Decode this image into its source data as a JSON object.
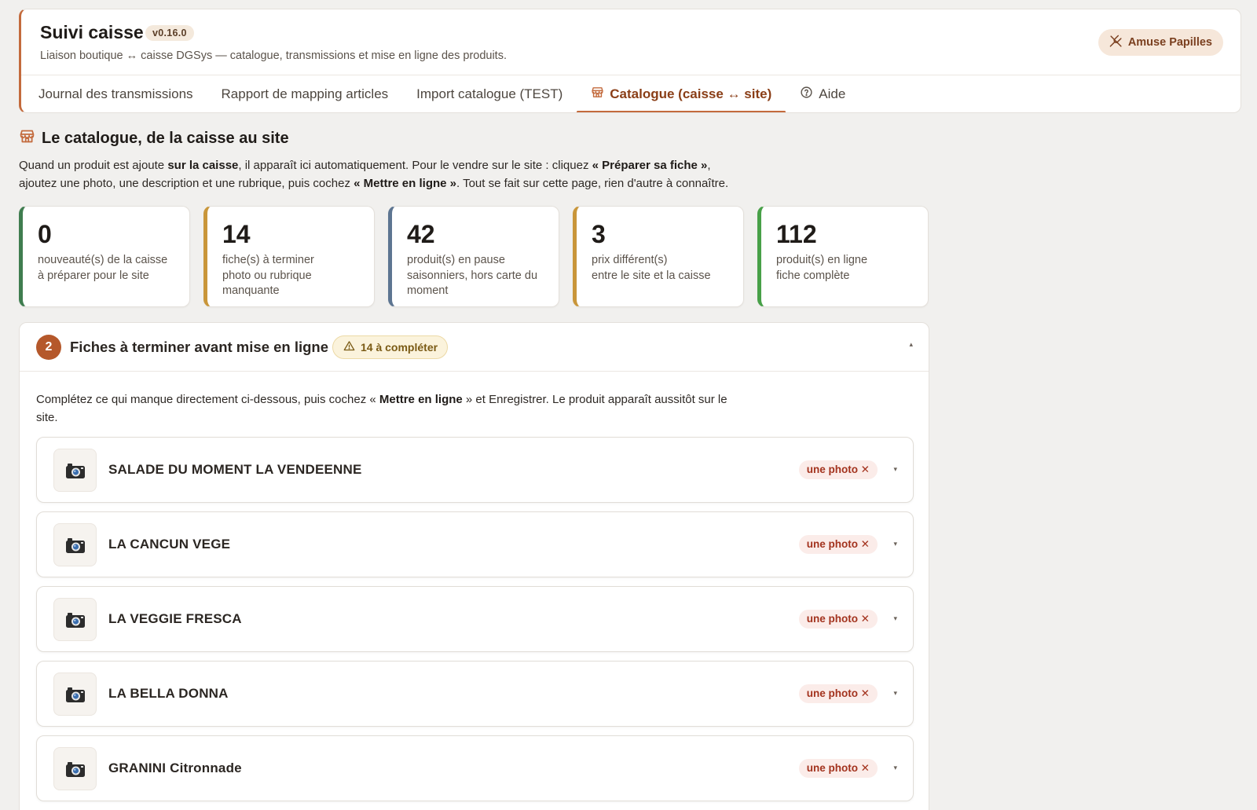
{
  "app": {
    "title": "Suivi caisse",
    "version": "v0.16.0",
    "subtitle": "Liaison boutique ↔ caisse DGSys — catalogue, transmissions et mise en ligne des produits.",
    "shop_label": "Amuse Papilles",
    "shop_icon": "utensils-crossed-icon"
  },
  "tabs": [
    {
      "label": "Journal des transmissions",
      "active": false
    },
    {
      "label": "Rapport de mapping articles",
      "active": false
    },
    {
      "label": "Import catalogue (TEST)",
      "active": false
    },
    {
      "label": "Catalogue (caisse ↔ site)",
      "active": true,
      "icon": "store-icon"
    },
    {
      "label": "Aide",
      "active": false,
      "icon": "help-circle-icon"
    }
  ],
  "section": {
    "title": "Le catalogue, de la caisse au site",
    "intro": {
      "p1": "Quand un produit est ajoute ",
      "b1": "sur la caisse",
      "p2": ", il apparaît ici automatiquement. Pour le vendre sur le site : cliquez ",
      "b2": "« Préparer sa fiche »",
      "p3": ",",
      "p4": "ajoutez une photo, une description et une rubrique, puis cochez ",
      "b3": "« Mettre en ligne »",
      "p5": ". Tout se fait sur cette page, rien d'autre à connaître."
    }
  },
  "stats": [
    {
      "value": "0",
      "label": "nouveauté(s) de la caisse",
      "sub": "à préparer pour le site",
      "color": "#3f7d4f"
    },
    {
      "value": "14",
      "label": "fiche(s) à terminer",
      "sub": "photo ou rubrique manquante",
      "color": "#c9963a"
    },
    {
      "value": "42",
      "label": "produit(s) en pause",
      "sub": "saisonniers, hors carte du moment",
      "color": "#5d7591"
    },
    {
      "value": "3",
      "label": "prix différent(s)",
      "sub": "entre le site et la caisse",
      "color": "#c9963a"
    },
    {
      "value": "112",
      "label": "produit(s) en ligne",
      "sub": "fiche complète",
      "color": "#47a047"
    }
  ],
  "panel": {
    "step": "2",
    "title": "Fiches à terminer avant mise en ligne",
    "badge": "14 à compléter",
    "toggle": "▴",
    "desc": {
      "p1": "Complétez ce qui manque directement ci-dessous, puis cochez « ",
      "b1": "Mettre en ligne",
      "p2": " » et Enregistrer. Le produit apparaît aussitôt sur le site."
    },
    "missing_label": "une photo ✕",
    "chevron": "▾",
    "products": [
      {
        "name": "SALADE DU MOMENT LA VENDEENNE"
      },
      {
        "name": "LA CANCUN VEGE"
      },
      {
        "name": "LA VEGGIE FRESCA"
      },
      {
        "name": "LA BELLA DONNA"
      },
      {
        "name": "GRANINI Citronnade"
      }
    ]
  },
  "colors": {
    "accent": "#c36a3c",
    "accent_dark": "#8a3e17",
    "warning": "#c9963a",
    "danger": "#a3331e"
  }
}
